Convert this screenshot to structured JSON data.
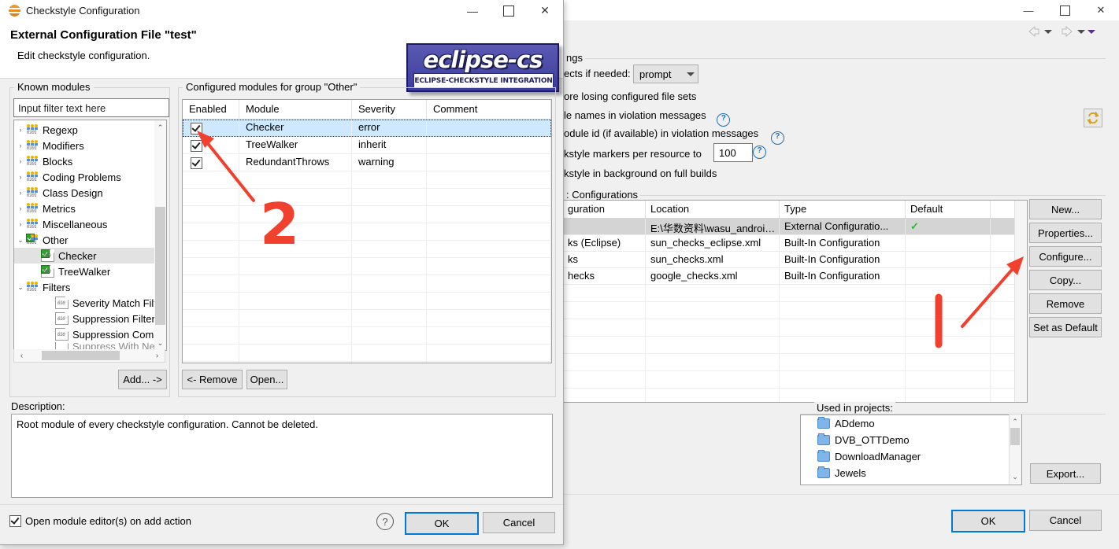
{
  "background_window": {
    "title_buttons": {
      "minimize": "—",
      "maximize": "▢",
      "close": "✕"
    },
    "toolbar": {
      "back": "back-arrow",
      "forward": "forward-arrow"
    },
    "restore_defaults_icon": "restore-defaults-icon",
    "settings": {
      "group_title": "ngs",
      "rebuild_label": "ects if needed:",
      "rebuild_value": "prompt",
      "warn_label": "ore losing configured file sets",
      "filenames_label": "le names in violation messages",
      "moduleid_label": "odule id (if available) in violation messages",
      "limit_label": "kstyle markers per resource to",
      "limit_value": "100",
      "background_label": "kstyle in background on full builds",
      "help_glyph": "?"
    },
    "configurations": {
      "group_title": ": Configurations",
      "columns": [
        "guration",
        "Location",
        "Type",
        "Default",
        ""
      ],
      "rows": [
        {
          "name": "",
          "location": "E:\\华数资料\\wasu_android...",
          "type": "External Configuratio...",
          "default": "✓",
          "selected": true
        },
        {
          "name": "ks (Eclipse)",
          "location": "sun_checks_eclipse.xml",
          "type": "Built-In Configuration",
          "default": "",
          "selected": false
        },
        {
          "name": "ks",
          "location": "sun_checks.xml",
          "type": "Built-In Configuration",
          "default": "",
          "selected": false
        },
        {
          "name": "hecks",
          "location": "google_checks.xml",
          "type": "Built-In Configuration",
          "default": "",
          "selected": false
        }
      ],
      "buttons": [
        "New...",
        "Properties...",
        "Configure...",
        "Copy...",
        "Remove",
        "Set as Default"
      ]
    },
    "used_in_projects": {
      "label": "Used in projects:",
      "items": [
        "ADdemo",
        "DVB_OTTDemo",
        "DownloadManager",
        "Jewels"
      ],
      "export_button": "Export..."
    },
    "footer": {
      "ok": "OK",
      "cancel": "Cancel"
    }
  },
  "dialog": {
    "title": "Checkstyle Configuration",
    "title_buttons": {
      "minimize": "—",
      "maximize": "▢",
      "close": "✕"
    },
    "heading": "External Configuration File \"test\"",
    "subheading": "Edit checkstyle configuration.",
    "logo": {
      "word": "eclipse-cs",
      "subtitle": "ECLIPSE-CHECKSTYLE INTEGRATION"
    },
    "known_modules": {
      "group_title": "Known modules",
      "filter_placeholder": "Input filter text here",
      "tree": [
        {
          "label": "Regexp",
          "indent": 0,
          "twisty": "›",
          "icon": "group-icon"
        },
        {
          "label": "Modifiers",
          "indent": 0,
          "twisty": "›",
          "icon": "group-icon"
        },
        {
          "label": "Blocks",
          "indent": 0,
          "twisty": "›",
          "icon": "group-icon"
        },
        {
          "label": "Coding Problems",
          "indent": 0,
          "twisty": "›",
          "icon": "group-icon"
        },
        {
          "label": "Class Design",
          "indent": 0,
          "twisty": "›",
          "icon": "group-icon"
        },
        {
          "label": "Metrics",
          "indent": 0,
          "twisty": "›",
          "icon": "group-icon"
        },
        {
          "label": "Miscellaneous",
          "indent": 0,
          "twisty": "›",
          "icon": "group-icon"
        },
        {
          "label": "Other",
          "indent": 0,
          "twisty": "⌄",
          "icon": "group-checked-icon"
        },
        {
          "label": "Checker",
          "indent": 1,
          "twisty": "",
          "icon": "module-checked-icon",
          "selected": true
        },
        {
          "label": "TreeWalker",
          "indent": 1,
          "twisty": "",
          "icon": "module-checked-icon"
        },
        {
          "label": "Filters",
          "indent": 0,
          "twisty": "⌄",
          "icon": "group-icon"
        },
        {
          "label": "Severity Match Filte",
          "indent": 1,
          "twisty": "",
          "icon": "module-icon"
        },
        {
          "label": "Suppression Filter",
          "indent": 1,
          "twisty": "",
          "icon": "module-icon"
        },
        {
          "label": "Suppression Comm",
          "indent": 1,
          "twisty": "",
          "icon": "module-icon"
        },
        {
          "label": "Suppress With Nea",
          "indent": 1,
          "twisty": "",
          "icon": "module-icon"
        }
      ],
      "add_button": "Add... ->"
    },
    "configured_modules": {
      "group_title": "Configured modules for group \"Other\"",
      "columns": [
        "Enabled",
        "Module",
        "Severity",
        "Comment"
      ],
      "rows": [
        {
          "enabled": true,
          "module": "Checker",
          "severity": "error",
          "comment": "",
          "selected": true
        },
        {
          "enabled": true,
          "module": "TreeWalker",
          "severity": "inherit",
          "comment": "",
          "selected": false
        },
        {
          "enabled": true,
          "module": "RedundantThrows",
          "severity": "warning",
          "comment": "",
          "selected": false
        }
      ],
      "remove_button": "<- Remove",
      "open_button": "Open..."
    },
    "description": {
      "label": "Description:",
      "text": "Root module of every checkstyle configuration. Cannot be deleted."
    },
    "footer": {
      "open_editor_checkbox": "Open module editor(s) on add action",
      "open_editor_checked": true,
      "help_glyph": "?",
      "ok": "OK",
      "cancel": "Cancel"
    }
  },
  "annotations": {
    "marker_one": "1",
    "marker_two": "2",
    "color": "#f2402e"
  }
}
